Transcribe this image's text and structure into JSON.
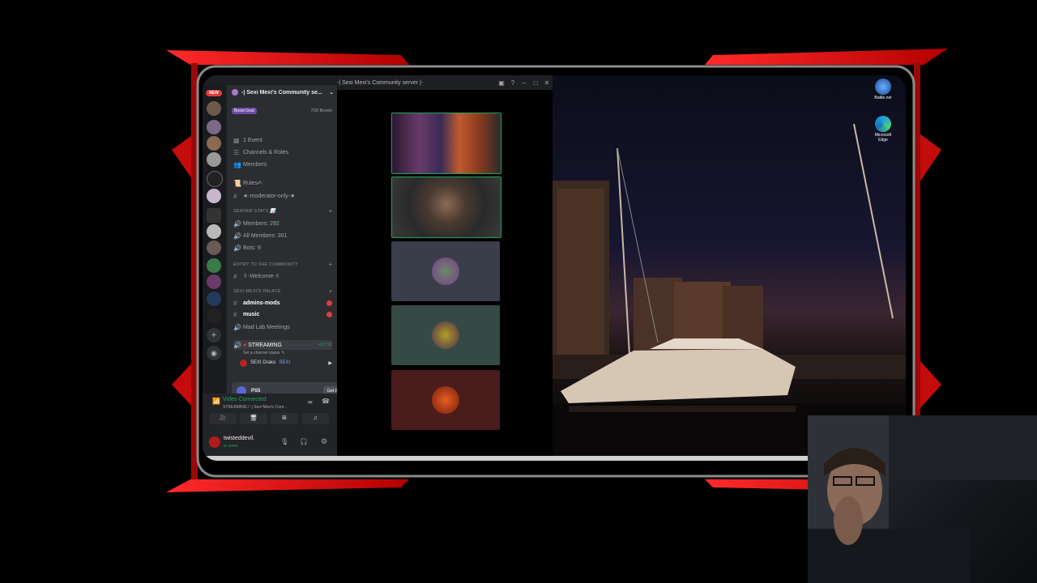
{
  "window": {
    "title": "-| Sexi Mexi's Community server |-"
  },
  "server": {
    "name": "-| Sexi Mexi's Community se...",
    "boost_goal": "Boost Goal",
    "boost_count": "7/20 Boosts"
  },
  "guild_badge": "NEW",
  "channels": [
    {
      "label": "1 Event",
      "icon": "calendar-icon",
      "kind": "item"
    },
    {
      "label": "Channels & Roles",
      "icon": "list-icon",
      "kind": "item"
    },
    {
      "label": "Members",
      "icon": "members-icon",
      "kind": "item"
    },
    {
      "label": "Rules✍",
      "icon": "rules-icon",
      "kind": "item"
    },
    {
      "label": "★-moderator-only-★",
      "icon": "hash-icon",
      "kind": "item"
    },
    {
      "label": "SERVER STATS 📊",
      "icon": "",
      "kind": "category"
    },
    {
      "label": "Members: 292",
      "icon": "speaker-icon",
      "kind": "item"
    },
    {
      "label": "All Members: 301",
      "icon": "speaker-icon",
      "kind": "item"
    },
    {
      "label": "Bots: 9",
      "icon": "speaker-icon",
      "kind": "item"
    },
    {
      "label": "ENTRY TO THE COMMUNITY",
      "icon": "",
      "kind": "category"
    },
    {
      "label": "✌-Welcome-✌",
      "icon": "hash-icon",
      "kind": "item"
    },
    {
      "label": "SEXI MEXI'S PALACE",
      "icon": "",
      "kind": "category"
    },
    {
      "label": "admins-mods",
      "icon": "hash-icon",
      "kind": "item"
    },
    {
      "label": "music",
      "icon": "hash-icon",
      "kind": "item"
    },
    {
      "label": "Mad Lab Meetings",
      "icon": "speaker-icon",
      "kind": "item"
    }
  ],
  "voice_channel": {
    "name": "STREAMING",
    "status": "Set a channel status",
    "timer": "4:17:12",
    "member": "SEXI Drako",
    "member_tag": "SEXI"
  },
  "ps5_promo": {
    "label": "PS5",
    "button": "Get Reward"
  },
  "voice_panel": {
    "status": "Video Connected",
    "location": "STREAMING / -| Sexi Mexi's Com..."
  },
  "user_panel": {
    "username": "twisteddevil.",
    "status": "In voice"
  },
  "desktop_icons": [
    {
      "label": "Battle.net",
      "icon": "battlenet-icon"
    },
    {
      "label": "Microsoft Edge",
      "icon": "edge-icon"
    }
  ],
  "colors": {
    "accent_red": "#e3171b",
    "discord_bg": "#2b2d31",
    "voice_green": "#23a55a"
  }
}
